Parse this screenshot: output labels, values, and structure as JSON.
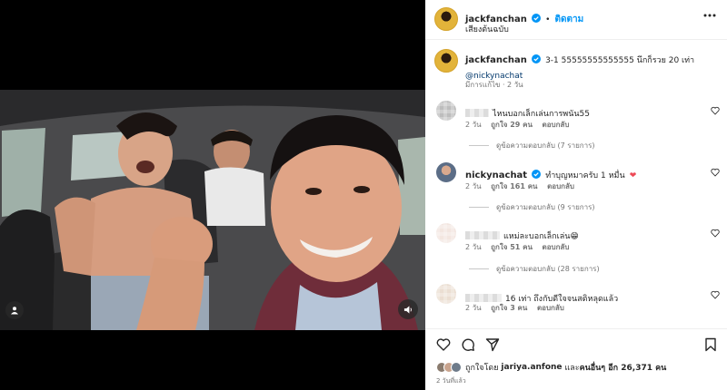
{
  "post": {
    "author": "jackfanchan",
    "follow_label": "ติดตาม",
    "dot": "•",
    "audio": "เสียงต้นฉบับ",
    "more_icon": "more-horizontal-icon"
  },
  "caption": {
    "author": "jackfanchan",
    "text": "3-1 55555555555555 นึกก็รวย 20 เท่า",
    "mention": "@nickynachat",
    "meta_edited": "มีการแก้ไข",
    "meta_time": "2 วัน"
  },
  "comments": [
    {
      "author_blurred": true,
      "text": "ไหนบอกเล็กเล่นการพนัน55",
      "time": "2 วัน",
      "likes": "ถูกใจ 29 คน",
      "reply_label": "ตอบกลับ",
      "view_replies": "ดูข้อความตอบกลับ (7 รายการ)"
    },
    {
      "author": "nickynachat",
      "text": "ทำบุญหมาครับ 1 หมื่น",
      "emoji": "❤",
      "time": "2 วัน",
      "likes": "ถูกใจ 161 คน",
      "reply_label": "ตอบกลับ",
      "view_replies": "ดูข้อความตอบกลับ (9 รายการ)"
    },
    {
      "author_blurred": true,
      "text": "แหม่ละบอกเล็กเล่น😁",
      "time": "2 วัน",
      "likes": "ถูกใจ 51 คน",
      "reply_label": "ตอบกลับ",
      "view_replies": "ดูข้อความตอบกลับ (28 รายการ)"
    },
    {
      "author_blurred": true,
      "text": "16 เท่า ถึงกับดีใจจนสติหลุดแล้ว",
      "time": "2 วัน",
      "likes": "ถูกใจ 3 คน",
      "reply_label": "ตอบกลับ"
    }
  ],
  "footer": {
    "likes_prefix": "ถูกใจโดย",
    "likes_user": "jariya.anfone",
    "likes_and": "และ",
    "likes_others": "คนอื่นๆ อีก 26,371 คน",
    "date": "2 วันที่แล้ว"
  },
  "colors": {
    "accent": "#0095f6",
    "verified": "#0095f6",
    "heart_red": "#ed4956",
    "avatar_gold": "#e2b33a"
  }
}
